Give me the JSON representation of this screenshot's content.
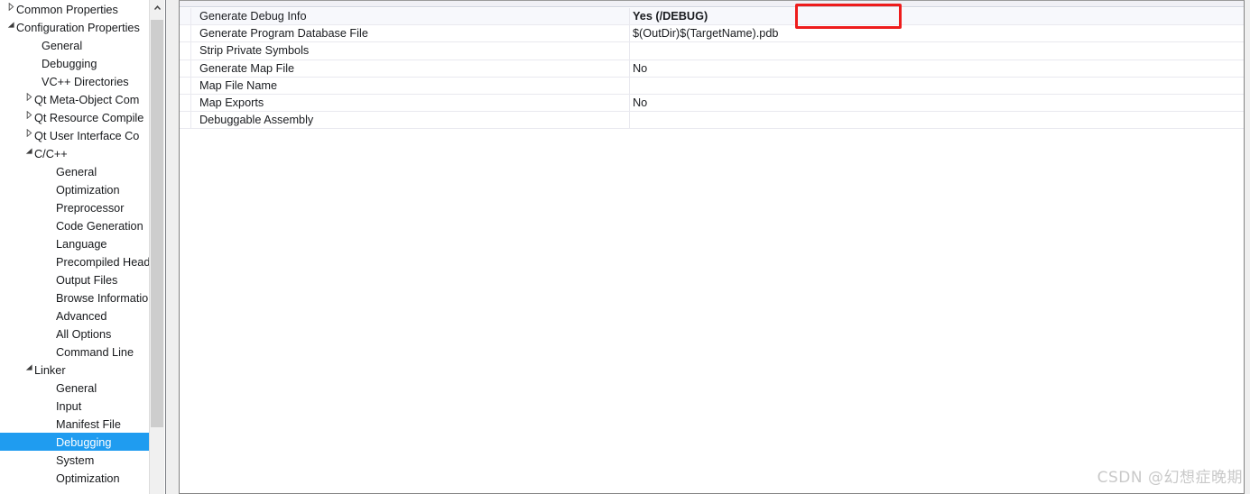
{
  "colors": {
    "selection": "#1f9cf0",
    "annotation": "#ee1c1c",
    "watermark": "#c9c9c9",
    "row_alt": "#f7f8fc",
    "pane_border": "#848484"
  },
  "tree": {
    "name": "configuration-tree",
    "scrollbar": {
      "up_arrow_glyph": "⌃"
    },
    "items": [
      {
        "label": "Common Properties",
        "level": 0,
        "expander": "collapsed",
        "selected": false
      },
      {
        "label": "Configuration Properties",
        "level": 0,
        "expander": "expanded",
        "selected": false
      },
      {
        "label": "General",
        "level": 1,
        "expander": "none",
        "selected": false
      },
      {
        "label": "Debugging",
        "level": 1,
        "expander": "none",
        "selected": false
      },
      {
        "label": "VC++ Directories",
        "level": 1,
        "expander": "none",
        "selected": false
      },
      {
        "label": "Qt Meta-Object Com",
        "level": 1,
        "expander": "collapsed",
        "selected": false
      },
      {
        "label": "Qt Resource Compile",
        "level": 1,
        "expander": "collapsed",
        "selected": false
      },
      {
        "label": "Qt User Interface Co",
        "level": 1,
        "expander": "collapsed",
        "selected": false
      },
      {
        "label": "C/C++",
        "level": 1,
        "expander": "expanded",
        "selected": false
      },
      {
        "label": "General",
        "level": 2,
        "expander": "none",
        "selected": false
      },
      {
        "label": "Optimization",
        "level": 2,
        "expander": "none",
        "selected": false
      },
      {
        "label": "Preprocessor",
        "level": 2,
        "expander": "none",
        "selected": false
      },
      {
        "label": "Code Generation",
        "level": 2,
        "expander": "none",
        "selected": false
      },
      {
        "label": "Language",
        "level": 2,
        "expander": "none",
        "selected": false
      },
      {
        "label": "Precompiled Head",
        "level": 2,
        "expander": "none",
        "selected": false
      },
      {
        "label": "Output Files",
        "level": 2,
        "expander": "none",
        "selected": false
      },
      {
        "label": "Browse Informatio",
        "level": 2,
        "expander": "none",
        "selected": false
      },
      {
        "label": "Advanced",
        "level": 2,
        "expander": "none",
        "selected": false
      },
      {
        "label": "All Options",
        "level": 2,
        "expander": "none",
        "selected": false
      },
      {
        "label": "Command Line",
        "level": 2,
        "expander": "none",
        "selected": false
      },
      {
        "label": "Linker",
        "level": 1,
        "expander": "expanded",
        "selected": false
      },
      {
        "label": "General",
        "level": 2,
        "expander": "none",
        "selected": false
      },
      {
        "label": "Input",
        "level": 2,
        "expander": "none",
        "selected": false
      },
      {
        "label": "Manifest File",
        "level": 2,
        "expander": "none",
        "selected": false
      },
      {
        "label": "Debugging",
        "level": 2,
        "expander": "none",
        "selected": true
      },
      {
        "label": "System",
        "level": 2,
        "expander": "none",
        "selected": false
      },
      {
        "label": "Optimization",
        "level": 2,
        "expander": "none",
        "selected": false
      }
    ]
  },
  "properties": {
    "name": "linker-debugging-property-grid",
    "rows": [
      {
        "name": "Generate Debug Info",
        "value": "Yes (/DEBUG)",
        "bold": true,
        "highlighted": true
      },
      {
        "name": "Generate Program Database File",
        "value": "$(OutDir)$(TargetName).pdb",
        "bold": false,
        "highlighted": false
      },
      {
        "name": "Strip Private Symbols",
        "value": "",
        "bold": false,
        "highlighted": false
      },
      {
        "name": "Generate Map File",
        "value": "No",
        "bold": false,
        "highlighted": false
      },
      {
        "name": "Map File Name",
        "value": "",
        "bold": false,
        "highlighted": false
      },
      {
        "name": "Map Exports",
        "value": "No",
        "bold": false,
        "highlighted": false
      },
      {
        "name": "Debuggable Assembly",
        "value": "",
        "bold": false,
        "highlighted": false
      }
    ]
  },
  "watermark": {
    "text": "CSDN @幻想症晚期"
  }
}
